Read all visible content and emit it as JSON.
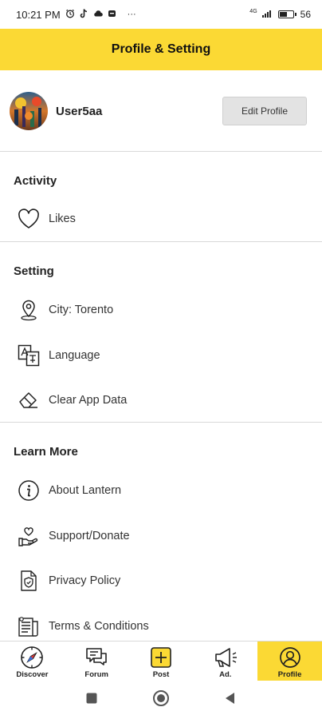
{
  "status_bar": {
    "time": "10:21 PM",
    "icons": [
      "alarm-icon",
      "tiktok-icon",
      "cloud-icon",
      "cast-icon",
      "more-icon"
    ],
    "more": "···",
    "network": "4G",
    "battery_percent": "56",
    "battery_fraction": 0.56
  },
  "header": {
    "title": "Profile & Setting"
  },
  "profile": {
    "username": "User5aa",
    "edit_label": "Edit Profile"
  },
  "sections": {
    "activity": {
      "title": "Activity",
      "items": [
        {
          "label": "Likes",
          "icon": "heart-icon"
        }
      ]
    },
    "setting": {
      "title": "Setting",
      "items": [
        {
          "label": "City: Torento",
          "icon": "location-pin-icon"
        },
        {
          "label": "Language",
          "icon": "translate-icon"
        },
        {
          "label": "Clear App Data",
          "icon": "eraser-icon"
        }
      ]
    },
    "learn_more": {
      "title": "Learn More",
      "items": [
        {
          "label": "About Lantern",
          "icon": "info-icon"
        },
        {
          "label": "Support/Donate",
          "icon": "donate-hand-heart-icon"
        },
        {
          "label": "Privacy Policy",
          "icon": "shield-document-icon"
        },
        {
          "label": "Terms & Conditions",
          "icon": "document-list-icon"
        }
      ]
    }
  },
  "bottom_nav": {
    "items": [
      {
        "label": "Discover",
        "icon": "compass-icon",
        "active": false
      },
      {
        "label": "Forum",
        "icon": "chat-bubbles-icon",
        "active": false
      },
      {
        "label": "Post",
        "icon": "plus-square-icon",
        "active": false
      },
      {
        "label": "Ad.",
        "icon": "megaphone-icon",
        "active": false
      },
      {
        "label": "Profile",
        "icon": "user-circle-icon",
        "active": true
      }
    ]
  },
  "colors": {
    "accent": "#fbd934",
    "divider": "#d9d9d9",
    "button_bg": "#e3e3e3"
  }
}
